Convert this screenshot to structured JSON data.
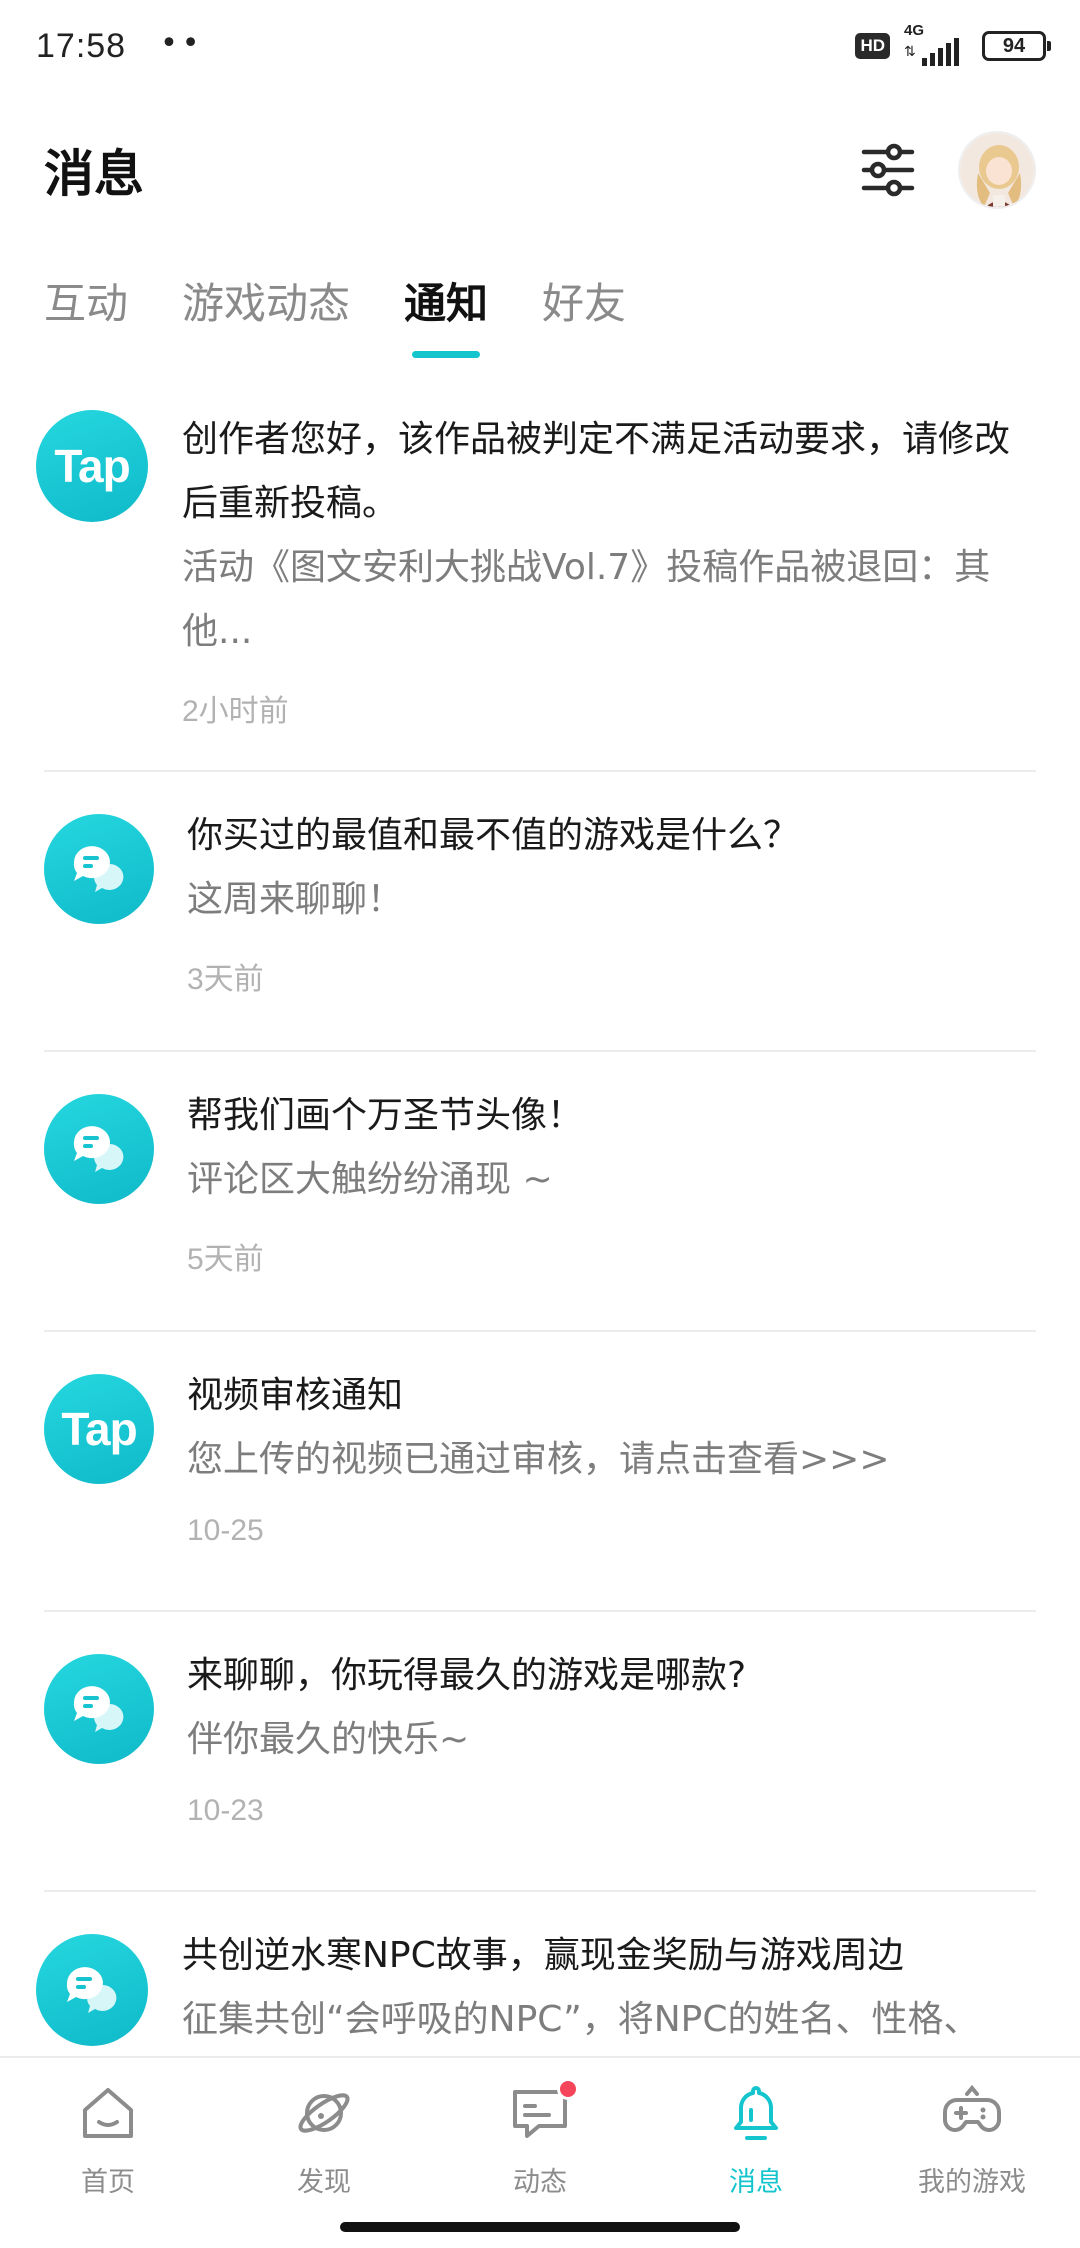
{
  "status_bar": {
    "time": "17:58",
    "dots": "••",
    "hd": "HD",
    "network": "4G",
    "battery": "94"
  },
  "header": {
    "title": "消息",
    "filter_icon": "sliders-icon",
    "avatar_icon": "user-avatar"
  },
  "tabs": [
    {
      "label": "互动",
      "active": false
    },
    {
      "label": "游戏动态",
      "active": false
    },
    {
      "label": "通知",
      "active": true
    },
    {
      "label": "好友",
      "active": false
    }
  ],
  "messages": [
    {
      "icon": "tap",
      "icon_text": "Tap",
      "title": "创作者您好，该作品被判定不满足活动要求，请修改后重新投稿。",
      "desc": "活动《图文安利大挑战Vol.7》投稿作品被退回：其他...",
      "time": "2小时前"
    },
    {
      "icon": "chat",
      "title": "你买过的最值和最不值的游戏是什么？",
      "desc": "这周来聊聊！",
      "time": "3天前"
    },
    {
      "icon": "chat",
      "title": "帮我们画个万圣节头像！",
      "desc": "评论区大触纷纷涌现 ~",
      "time": "5天前"
    },
    {
      "icon": "tap",
      "icon_text": "Tap",
      "title": "视频审核通知",
      "desc": "您上传的视频已通过审核，请点击查看>>>",
      "time": "10-25"
    },
    {
      "icon": "chat",
      "title": "来聊聊，你玩得最久的游戏是哪款?",
      "desc": "伴你最久的快乐~",
      "time": "10-23"
    },
    {
      "icon": "chat",
      "title": "共创逆水寒NPC故事，赢现金奖励与游戏周边",
      "desc": "征集共创“会呼吸的NPC”，将NPC的姓名、性格、",
      "time": ""
    }
  ],
  "bottom_nav": [
    {
      "label": "首页",
      "icon": "home-icon",
      "active": false
    },
    {
      "label": "发现",
      "icon": "planet-icon",
      "active": false
    },
    {
      "label": "动态",
      "icon": "chat-bubble-icon",
      "active": false,
      "badge": true
    },
    {
      "label": "消息",
      "icon": "bell-icon",
      "active": true
    },
    {
      "label": "我的游戏",
      "icon": "gamepad-icon",
      "active": false
    }
  ],
  "colors": {
    "accent": "#15c5ce",
    "badge": "#f5455b",
    "text_primary": "#1a1a1a",
    "text_secondary": "#7d7d7d",
    "text_time": "#b2b2b2"
  }
}
